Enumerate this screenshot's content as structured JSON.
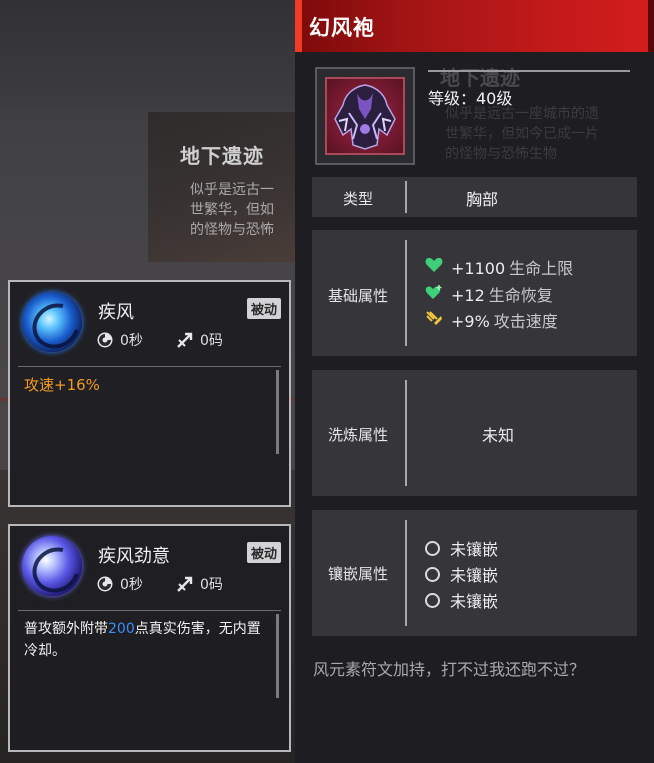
{
  "background": {
    "card_title": "地下遗迹",
    "card_lines": [
      "似乎是远古一",
      "世繁华，但如",
      "的怪物与恐怖"
    ]
  },
  "skills": [
    {
      "name": "疾风",
      "badge": "被动",
      "cooldown": "0秒",
      "cost": "0码",
      "icon": "wind-swirl-skill-icon",
      "desc": "攻速+16%"
    },
    {
      "name": "疾风劲意",
      "badge": "被动",
      "cooldown": "0秒",
      "cost": "0码",
      "icon": "wind-blade-skill-icon",
      "desc_pre": "普攻额外附带",
      "desc_num": "200",
      "desc_post": "点真实伤害，无内置冷却。"
    }
  ],
  "item": {
    "name": "幻风袍",
    "level": "等级：40级",
    "ghost_title": "地下遗迹",
    "ghost_lines": [
      "似乎是远古一座城市的遗",
      "世繁华，但如今已成一片",
      "的怪物与恐怖生物"
    ],
    "type_label": "类型",
    "type_value": "胸部",
    "base_label": "基础属性",
    "base_attrs": [
      {
        "value": "+1100",
        "name": "生命上限",
        "icon": "heart-icon"
      },
      {
        "value": "+12",
        "name": "生命恢复",
        "icon": "heart-regen-icon"
      },
      {
        "value": "+9%",
        "name": "攻击速度",
        "icon": "attack-speed-icon"
      }
    ],
    "refine_label": "洗炼属性",
    "refine_value": "未知",
    "socket_label": "镶嵌属性",
    "sockets": [
      "未镶嵌",
      "未镶嵌",
      "未镶嵌"
    ],
    "flavor": "风元素符文加持，打不过我还跑不过？"
  },
  "colors": {
    "title_bar": "#c21a1a",
    "passive_desc": "#f39a1e",
    "highlight": "#3d8cff",
    "heart": "#3fcf7a"
  }
}
